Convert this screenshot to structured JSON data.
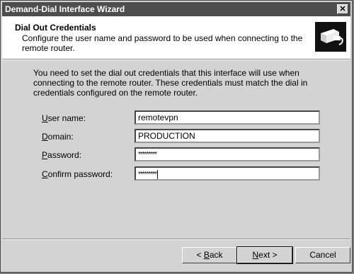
{
  "window": {
    "title": "Demand-Dial Interface Wizard",
    "close_glyph": "✕"
  },
  "header": {
    "title": "Dial Out Credentials",
    "description": "Configure the user name and password to be used when connecting to the remote router.",
    "icon": "network-cable-icon"
  },
  "body": {
    "instructions": "You need to set the dial out credentials that this interface will use when connecting to the remote router.  These credentials must match the dial in credentials configured on the remote router."
  },
  "form": {
    "username": {
      "label_first": "U",
      "label_rest": "ser name:",
      "value": "remotevpn"
    },
    "domain": {
      "label_first": "D",
      "label_rest": "omain:",
      "value": "PRODUCTION"
    },
    "password": {
      "label_first": "P",
      "label_rest": "assword:",
      "value": "*********"
    },
    "confirm": {
      "label_first": "C",
      "label_rest": "onfirm password:",
      "value": "*********"
    }
  },
  "buttons": {
    "back_prefix": "< ",
    "back_first": "B",
    "back_rest": "ack",
    "next_first": "N",
    "next_rest": "ext >",
    "cancel": "Cancel"
  }
}
